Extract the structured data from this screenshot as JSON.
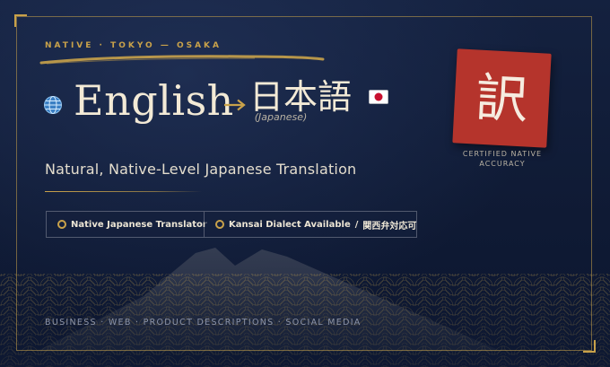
{
  "eyebrow": "NATIVE · TOKYO — OSAKA",
  "headline": {
    "source_language": "English",
    "target_language": "日本語",
    "target_language_note": "(Japanese)"
  },
  "seal": {
    "character": "訳",
    "caption_line1": "CERTIFIED NATIVE",
    "caption_line2": "ACCURACY"
  },
  "tagline": "Natural, Native-Level Japanese Translation",
  "badges": [
    {
      "label": "Native Japanese Translator"
    },
    {
      "label": "Kansai Dialect Available",
      "separator": "/",
      "label_jp": "関西弁対応可"
    }
  ],
  "footer": "BUSINESS · WEB · PRODUCT DESCRIPTIONS · SOCIAL MEDIA",
  "icons": {
    "globe": "globe-icon",
    "arrow": "arrow-right-icon",
    "flag": "japan-flag-icon",
    "badge_bullet": "circle-bullet-icon"
  },
  "colors": {
    "background": "#0f1a33",
    "gold": "#c9a24a",
    "seal_red": "#b5342c",
    "text_light": "#f3ead6"
  }
}
